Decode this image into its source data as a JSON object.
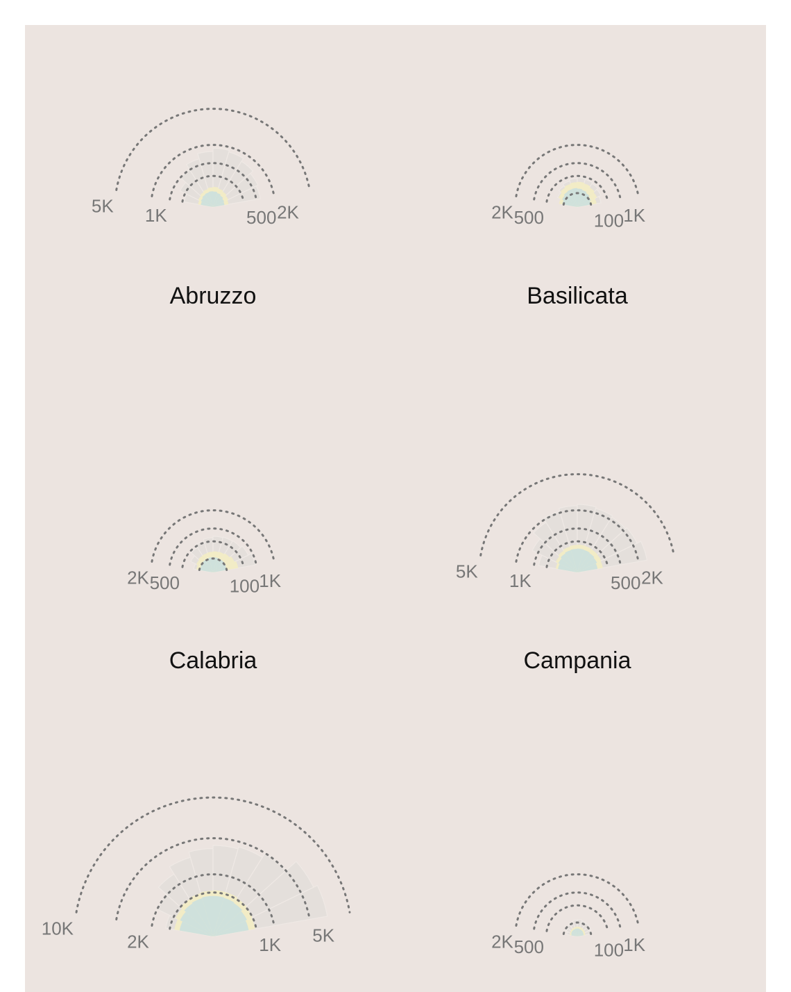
{
  "colors": {
    "background": "#ece4e0",
    "outer_bars": "#e4dfdb",
    "middle_bars": "#f2ecc6",
    "inner_bars": "#cfe1dc",
    "rings": "#777777",
    "tick_labels": "#777777",
    "titles": "#111111"
  },
  "chart_data": [
    {
      "type": "radial-bar",
      "title": "Abruzzo",
      "ring_labels": [
        "5K",
        "1K",
        "500",
        "2K"
      ],
      "ring_values": [
        5000,
        1000,
        500,
        2000
      ],
      "series": [
        {
          "values": [
            450,
            700,
            1000,
            1300,
            1600,
            1800,
            1700,
            1500,
            1300,
            1200
          ]
        },
        {
          "values": [
            120,
            140,
            160,
            180,
            200,
            210,
            190,
            170,
            150,
            130
          ]
        },
        {
          "values": [
            80,
            95,
            110,
            120,
            130,
            125,
            110,
            95,
            80,
            70
          ]
        }
      ]
    },
    {
      "type": "radial-bar",
      "title": "Basilicata",
      "ring_labels": [
        "2K",
        "500",
        "100",
        "1K"
      ],
      "ring_values": [
        2000,
        500,
        100,
        1000
      ],
      "series": [
        {
          "values": [
            150,
            250,
            320,
            380,
            420,
            450,
            430,
            400,
            360,
            300
          ]
        },
        {
          "values": [
            180,
            230,
            270,
            300,
            320,
            330,
            310,
            280,
            250,
            200
          ]
        },
        {
          "values": [
            120,
            150,
            170,
            180,
            185,
            175,
            160,
            140,
            120,
            100
          ]
        }
      ]
    },
    {
      "type": "radial-bar",
      "title": "Calabria",
      "ring_labels": [
        "2K",
        "500",
        "100",
        "1K"
      ],
      "ring_values": [
        2000,
        500,
        100,
        1000
      ],
      "series": [
        {
          "values": [
            200,
            320,
            450,
            550,
            620,
            680,
            700,
            720,
            800,
            950
          ]
        },
        {
          "values": [
            150,
            180,
            200,
            210,
            220,
            230,
            240,
            260,
            300,
            340
          ]
        },
        {
          "values": [
            90,
            100,
            110,
            115,
            120,
            120,
            118,
            115,
            110,
            100
          ]
        }
      ]
    },
    {
      "type": "radial-bar",
      "title": "Campania",
      "ring_labels": [
        "5K",
        "1K",
        "500",
        "2K"
      ],
      "ring_values": [
        5000,
        1000,
        500,
        2000
      ],
      "series": [
        {
          "values": [
            800,
            1300,
            1800,
            2100,
            2300,
            2400,
            2300,
            2200,
            2300,
            2600
          ]
        },
        {
          "values": [
            250,
            300,
            340,
            370,
            390,
            400,
            390,
            380,
            370,
            350
          ]
        },
        {
          "values": [
            200,
            230,
            260,
            280,
            290,
            295,
            285,
            270,
            250,
            220
          ]
        }
      ]
    },
    {
      "type": "radial-bar",
      "title": "",
      "ring_labels": [
        "10K",
        "2K",
        "1K",
        "5K"
      ],
      "ring_values": [
        10000,
        2000,
        1000,
        5000
      ],
      "series": [
        {
          "values": [
            1200,
            2000,
            2800,
            3500,
            4000,
            4300,
            4500,
            5000,
            6500,
            7000
          ]
        },
        {
          "values": [
            800,
            900,
            1000,
            1050,
            1080,
            1100,
            1100,
            1050,
            1000,
            950
          ]
        },
        {
          "values": [
            600,
            700,
            780,
            820,
            850,
            850,
            830,
            800,
            740,
            680
          ]
        }
      ]
    },
    {
      "type": "radial-bar",
      "title": "",
      "ring_labels": [
        "2K",
        "500",
        "100",
        "1K"
      ],
      "ring_values": [
        2000,
        500,
        100,
        1000
      ],
      "series": [
        {
          "values": [
            60,
            80,
            100,
            120,
            140,
            150,
            140,
            130,
            120,
            100
          ]
        },
        {
          "values": [
            30,
            35,
            40,
            45,
            48,
            50,
            48,
            45,
            40,
            35
          ]
        },
        {
          "values": [
            20,
            25,
            28,
            30,
            32,
            32,
            30,
            28,
            25,
            22
          ]
        }
      ]
    }
  ]
}
